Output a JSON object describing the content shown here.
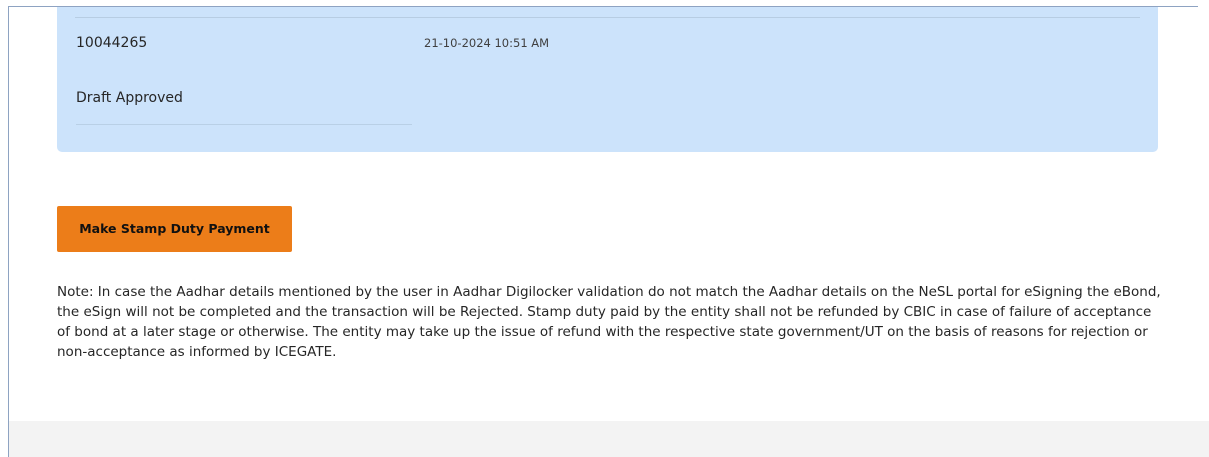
{
  "record": {
    "reference_number": "10044265",
    "datetime": "21-10-2024 10:51 AM",
    "status": "Draft Approved"
  },
  "actions": {
    "make_stamp_duty_payment": "Make Stamp Duty Payment"
  },
  "note": {
    "text": "Note: In case the Aadhar details mentioned by the user in Aadhar Digilocker validation do not match the Aadhar details on the NeSL portal for eSigning the eBond, the eSign will not be completed and the transaction will be Rejected. Stamp duty paid by the entity shall not be refunded by CBIC in case of failure of acceptance of bond at a later stage or otherwise. The entity may take up the issue of refund with the respective state government/UT on the basis of reasons for rejection or non-acceptance as informed by ICEGATE."
  },
  "colors": {
    "panel_background": "#cce3fb",
    "button_background": "#ec7d19",
    "footer_background": "#f3f3f3"
  }
}
